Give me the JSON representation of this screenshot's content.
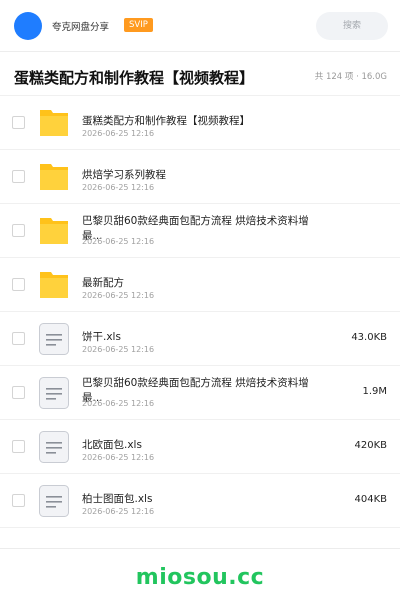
{
  "header": {
    "brand": "夸克网盘分享",
    "badge": "SVIP",
    "search_label": "搜索"
  },
  "folder_title": "蛋糕类配方和制作教程【视频教程】",
  "summary": "共 124 项 · 16.0G",
  "items": [
    {
      "type": "folder",
      "name": "蛋糕类配方和制作教程【视频教程】",
      "date": "2026-06-25 12:16",
      "size": ""
    },
    {
      "type": "folder",
      "name": "烘焙学习系列教程",
      "date": "2026-06-25 12:16",
      "size": ""
    },
    {
      "type": "folder",
      "name": "巴黎贝甜60款经典面包配方流程 烘焙技术资料增最...",
      "date": "2026-06-25 12:16",
      "size": ""
    },
    {
      "type": "folder",
      "name": "最新配方",
      "date": "2026-06-25 12:16",
      "size": ""
    },
    {
      "type": "file",
      "name": "饼干.xls",
      "date": "2026-06-25 12:16",
      "size": "43.0KB"
    },
    {
      "type": "file",
      "name": "巴黎贝甜60款经典面包配方流程 烘焙技术资料增最...",
      "date": "2026-06-25 12:16",
      "size": "1.9M"
    },
    {
      "type": "file",
      "name": "北欧面包.xls",
      "date": "2026-06-25 12:16",
      "size": "420KB"
    },
    {
      "type": "file",
      "name": "柏士图面包.xls",
      "date": "2026-06-25 12:16",
      "size": "404KB"
    }
  ],
  "watermark": "miosou.cc",
  "colors": {
    "accent": "#1f7dff",
    "badge": "#ff9a1f",
    "folder": "#ffc21a",
    "watermark": "#22c55e"
  }
}
